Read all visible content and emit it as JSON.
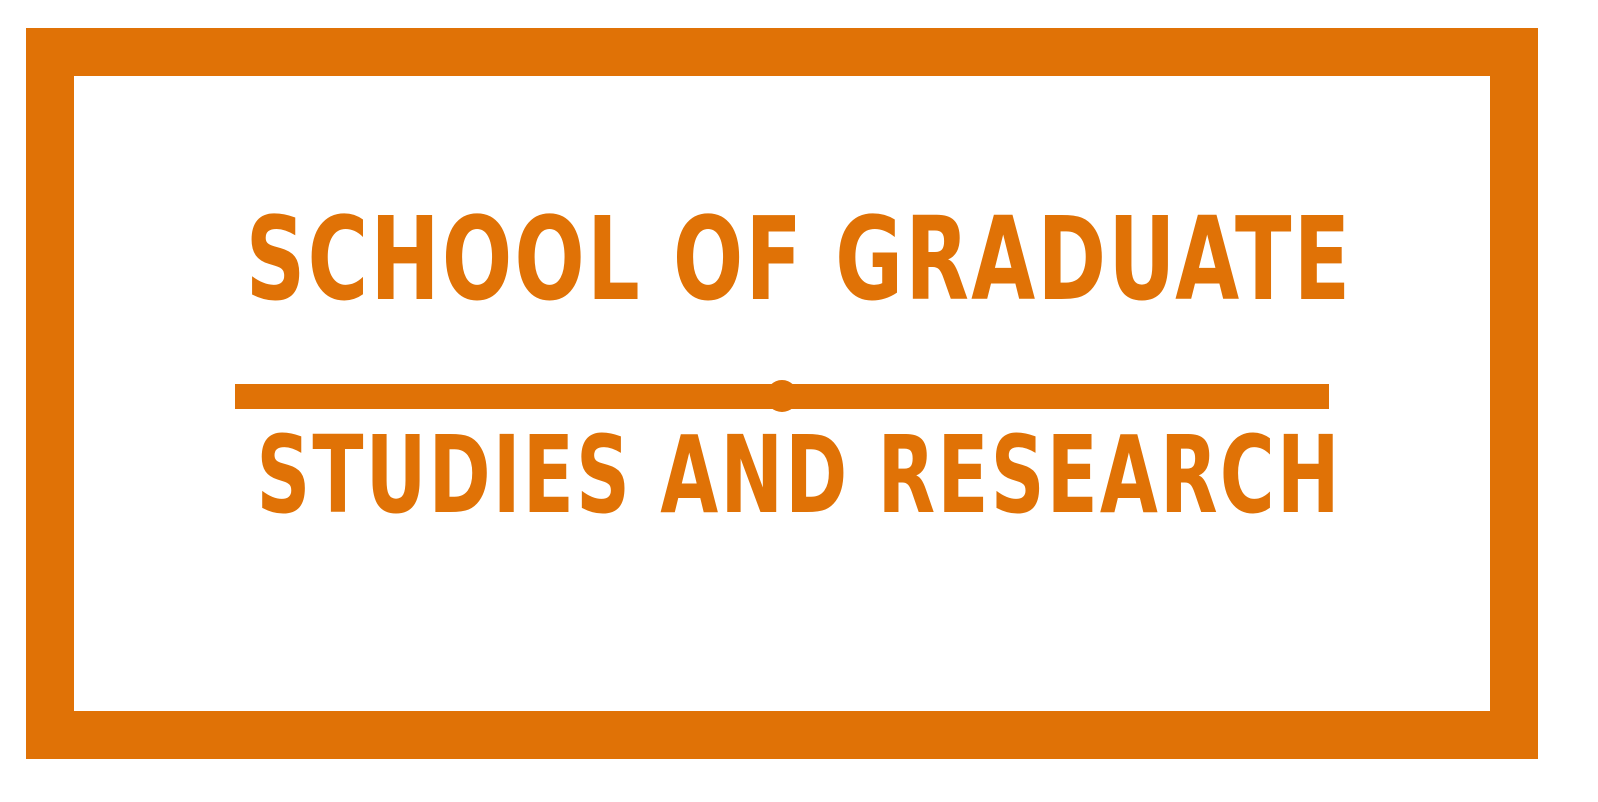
{
  "logo": {
    "line1": "SCHOOL OF GRADUATE",
    "line2": "STUDIES AND RESEARCH",
    "brand_color": "#e07206",
    "background_color": "#ffffff"
  }
}
